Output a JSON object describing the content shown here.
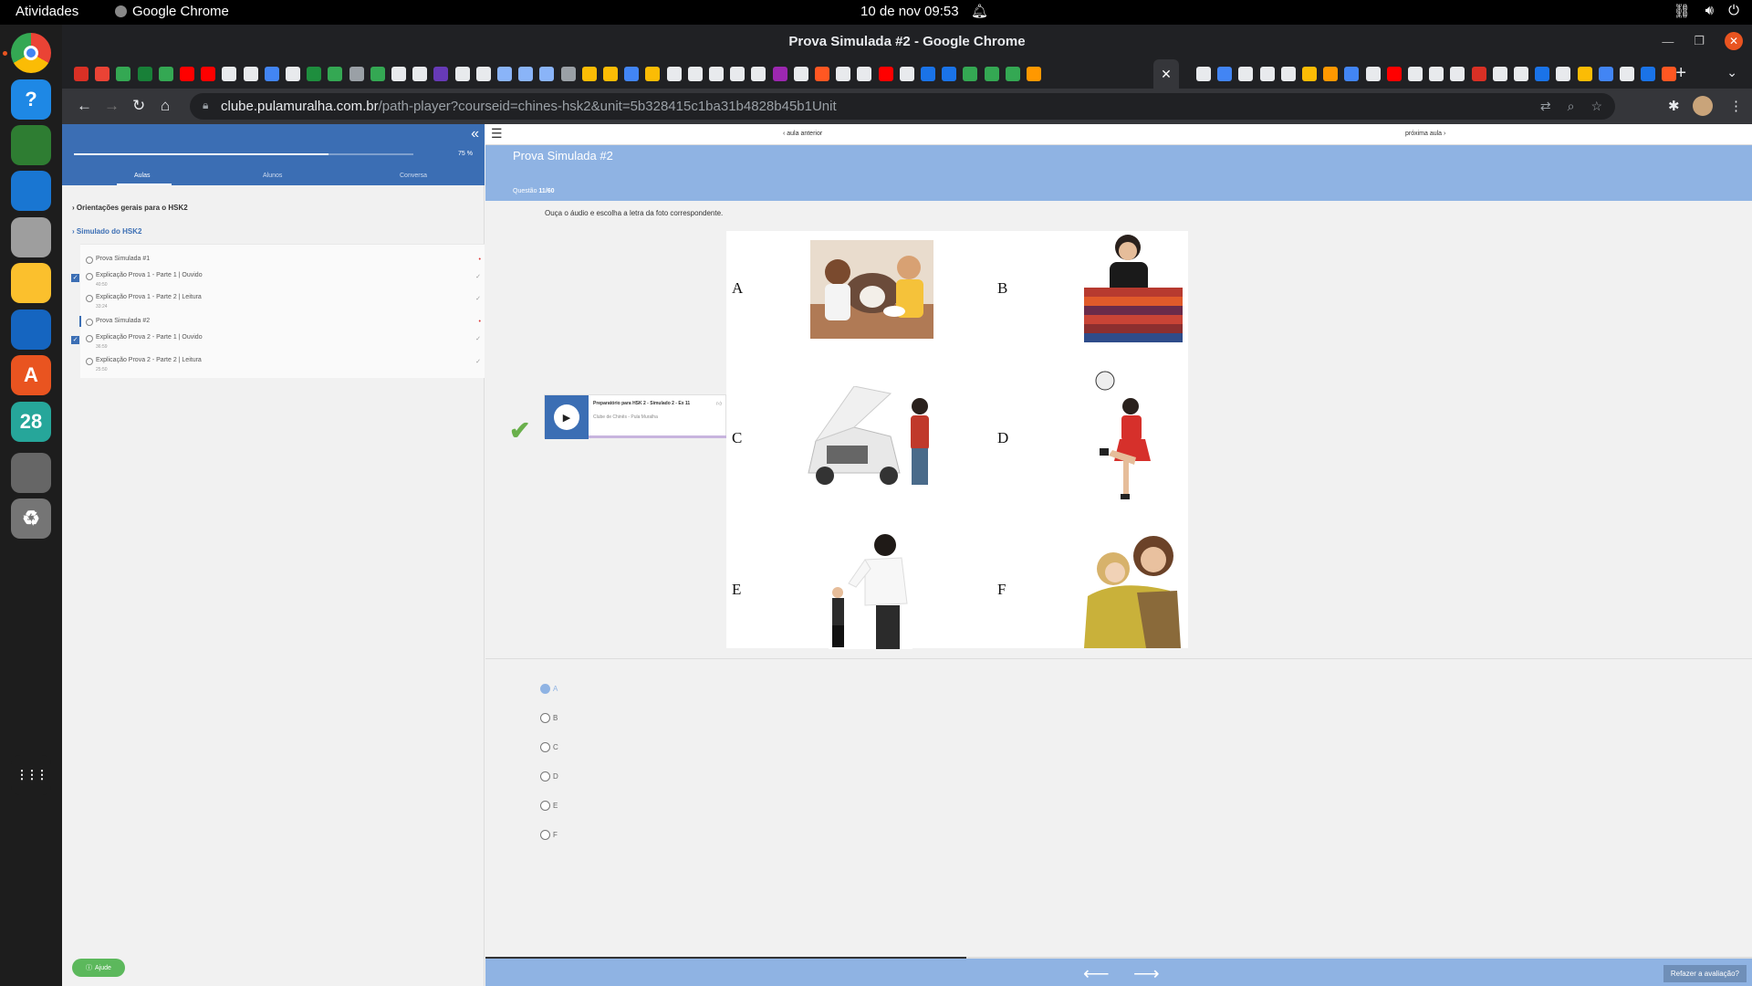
{
  "os": {
    "activities": "Atividades",
    "app_name": "Google Chrome",
    "clock": "10 de nov  09:53",
    "tray_icons": [
      "network-icon",
      "volume-icon",
      "power-icon"
    ]
  },
  "dock": {
    "items": [
      {
        "name": "chrome-icon",
        "color": "#4285f4"
      },
      {
        "name": "help-icon",
        "color": "#1e88e5",
        "glyph": "?"
      },
      {
        "name": "app-cube-icon",
        "color": "#2e7d32"
      },
      {
        "name": "thunderbird-icon",
        "color": "#1976d2"
      },
      {
        "name": "files-icon",
        "color": "#9e9e9e"
      },
      {
        "name": "rhythmbox-icon",
        "color": "#fbc02d"
      },
      {
        "name": "writer-icon",
        "color": "#1565c0"
      },
      {
        "name": "app-center-icon",
        "color": "#e95420",
        "glyph": "A"
      },
      {
        "name": "calendar-icon",
        "color": "#26a69a",
        "glyph": "28"
      },
      {
        "name": "drive-icon",
        "color": "#666666"
      },
      {
        "name": "trash-icon",
        "color": "#757575",
        "glyph": "♻"
      },
      {
        "name": "show-apps-icon",
        "color": "#1d1d1d",
        "glyph": "⋮⋮⋮"
      }
    ]
  },
  "browser": {
    "window_title": "Prova Simulada #2 - Google Chrome",
    "active_tab_close": "✕",
    "url_host": "clube.pulamuralha.com.br",
    "url_path": "/path-player?courseid=chines-hsk2&unit=5b328415c1ba31b4828b45b1Unit"
  },
  "sidebar": {
    "progress_percent": 75,
    "progress_label": "75 %",
    "tabs": [
      "Aulas",
      "Alunos",
      "Conversa"
    ],
    "sections": [
      {
        "title": "Orientações gerais para o HSK2"
      },
      {
        "title": "Simulado do HSK2"
      }
    ],
    "lessons": [
      {
        "title": "Prova Simulada #1",
        "duration": "",
        "status": "•",
        "checked": false
      },
      {
        "title": "Explicação Prova 1 - Parte 1 | Ouvido",
        "duration": "40:50",
        "status": "✓",
        "checked": true
      },
      {
        "title": "Explicação Prova 1 - Parte 2 | Leitura",
        "duration": "33:24",
        "status": "✓",
        "checked": false
      },
      {
        "title": "Prova Simulada #2",
        "duration": "",
        "status": "•",
        "checked": false
      },
      {
        "title": "Explicação Prova 2 - Parte 1 | Ouvido",
        "duration": "36:59",
        "status": "✓",
        "checked": true
      },
      {
        "title": "Explicação Prova 2 - Parte 2 | Leitura",
        "duration": "25:50",
        "status": "✓",
        "checked": false
      }
    ],
    "help": "Ajude"
  },
  "main": {
    "prev": "‹ aula anterior",
    "next": "próxima aula ›",
    "title": "Prova Simulada #2",
    "question_prefix": "Questão",
    "question_number": "11/60",
    "instruction": "Ouça o áudio e escolha a letra da foto correspondente.",
    "player": {
      "title": "Preparatório para HSK 2 - Simulado 2 - Ex 11",
      "author": "Clube de Chinês - Pula Muralha"
    },
    "grid_letters": [
      "A",
      "B",
      "C",
      "D",
      "E",
      "F"
    ],
    "options": [
      "A",
      "B",
      "C",
      "D",
      "E",
      "F"
    ],
    "selected_option": "A",
    "bottom_progress": 0.38,
    "redo": "Refazer a avaliação?"
  }
}
